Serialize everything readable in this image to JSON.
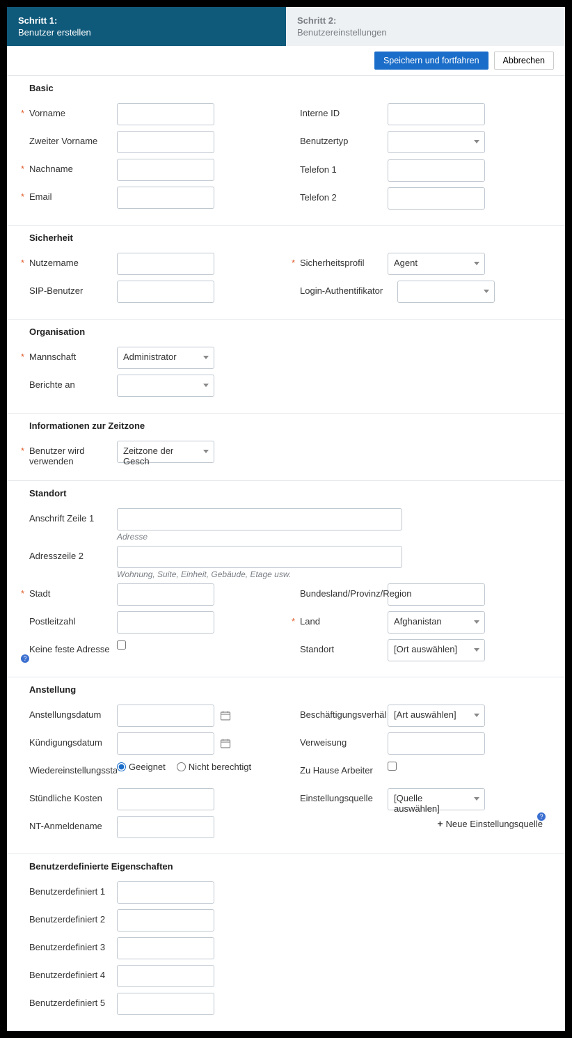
{
  "tabs": [
    {
      "title": "Schritt 1:",
      "sub": "Benutzer erstellen"
    },
    {
      "title": "Schritt 2:",
      "sub": "Benutzereinstellungen"
    }
  ],
  "toolbar": {
    "save": "Speichern und fortfahren",
    "cancel": "Abbrechen"
  },
  "sections": {
    "basic": {
      "title": "Basic",
      "vorname": "Vorname",
      "zweiter": "Zweiter Vorname",
      "nachname": "Nachname",
      "email": "Email",
      "interne": "Interne ID",
      "benutzertyp": "Benutzertyp",
      "tel1": "Telefon 1",
      "tel2": "Telefon 2"
    },
    "sicherheit": {
      "title": "Sicherheit",
      "nutzer": "Nutzername",
      "sip": "SIP-Benutzer",
      "profil": "Sicherheitsprofil",
      "login": "Login-Authentifikator",
      "profil_val": "Agent"
    },
    "org": {
      "title": "Organisation",
      "mannschaft": "Mannschaft",
      "berichte": "Berichte an",
      "mannschaft_val": "Administrator"
    },
    "tz": {
      "title": "Informationen zur Zeitzone",
      "label": "Benutzer wird verwenden",
      "val": "Zeitzone der Gesch"
    },
    "standort": {
      "title": "Standort",
      "a1": "Anschrift Zeile 1",
      "a1_help": "Adresse",
      "a2": "Adresszeile 2",
      "a2_help": "Wohnung, Suite, Einheit, Gebäude, Etage usw.",
      "stadt": "Stadt",
      "plz": "Postleitzahl",
      "kfa": "Keine feste Adresse",
      "region": "Bundesland/Provinz/Region",
      "land": "Land",
      "land_val": "Afghanistan",
      "standort": "Standort",
      "standort_val": "[Ort auswählen]"
    },
    "anstellung": {
      "title": "Anstellung",
      "adatum": "Anstellungsdatum",
      "kdatum": "Kündigungsdatum",
      "wstatus": "Wiedereinstellungssta",
      "geeignet": "Geeignet",
      "nicht": "Nicht berechtigt",
      "stund": "Stündliche Kosten",
      "nt": "NT-Anmeldename",
      "besch": "Beschäftigungsverhäl",
      "besch_val": "[Art auswählen]",
      "verw": "Verweisung",
      "zuhause": "Zu Hause Arbeiter",
      "quelle": "Einstellungsquelle",
      "quelle_val": "[Quelle auswählen]",
      "neue": "Neue Einstellungsquelle"
    },
    "custom": {
      "title": "Benutzerdefinierte Eigenschaften",
      "f1": "Benutzerdefiniert 1",
      "f2": "Benutzerdefiniert 2",
      "f3": "Benutzerdefiniert 3",
      "f4": "Benutzerdefiniert 4",
      "f5": "Benutzerdefiniert 5"
    }
  }
}
